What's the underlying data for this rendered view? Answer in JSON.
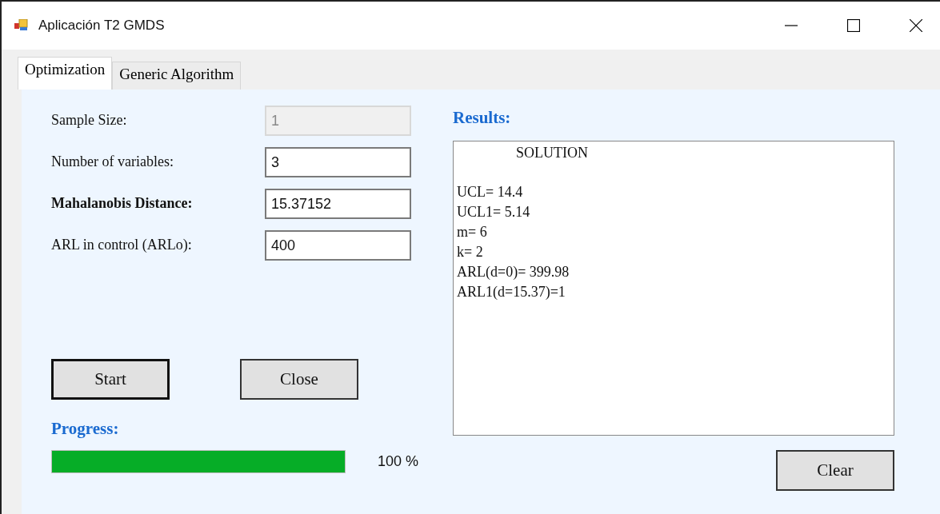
{
  "window": {
    "title": "Aplicación T2 GMDS"
  },
  "tabs": [
    {
      "label": "Optimization",
      "selected": true
    },
    {
      "label": "Generic Algorithm",
      "selected": false
    }
  ],
  "fields": [
    {
      "label": "Sample Size:",
      "value": "1",
      "disabled": true,
      "emphasized": false
    },
    {
      "label": "Number of variables:",
      "value": "3",
      "disabled": false,
      "emphasized": false
    },
    {
      "label": "Mahalanobis Distance:",
      "value": "15.37152",
      "disabled": false,
      "emphasized": true
    },
    {
      "label": "ARL in control (ARLo):",
      "value": "400",
      "disabled": false,
      "emphasized": false
    }
  ],
  "buttons": [
    {
      "label": "Start",
      "default": true
    },
    {
      "label": "Close",
      "default": false
    }
  ],
  "progress": {
    "label": "Progress:",
    "level": 1,
    "reading": "100 %"
  },
  "results": {
    "label": "Results:",
    "heading": "SOLUTION",
    "lines": [
      "UCL= 14.4",
      "UCL1= 5.14",
      "m= 6",
      "k= 2",
      "ARL(d=0)= 399.98",
      "ARL1(d=15.37)=1"
    ]
  },
  "clear_button": {
    "label": "Clear"
  }
}
